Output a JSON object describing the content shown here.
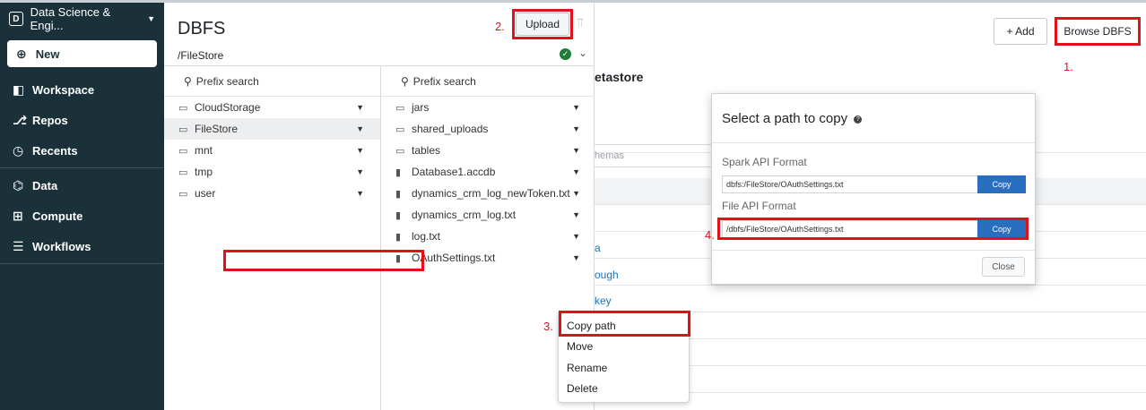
{
  "sidebar": {
    "workspace_badge": "D",
    "workspace_name": "Data Science & Engi...",
    "workspace_caret": "▼",
    "new_label": "New",
    "items": [
      {
        "label": "Workspace",
        "icon": "workspace-icon",
        "glyph": "◧"
      },
      {
        "label": "Repos",
        "icon": "repos-icon",
        "glyph": "⎇"
      },
      {
        "label": "Recents",
        "icon": "clock-icon",
        "glyph": "◷"
      },
      {
        "label": "Data",
        "icon": "data-icon",
        "glyph": "⌬"
      },
      {
        "label": "Compute",
        "icon": "compute-icon",
        "glyph": "⊞"
      },
      {
        "label": "Workflows",
        "icon": "workflows-icon",
        "glyph": "☰"
      }
    ]
  },
  "dbfs": {
    "title": "DBFS",
    "upload_label": "Upload",
    "path": "/FileStore",
    "search_placeholder": "Prefix search",
    "left_folders": [
      "CloudStorage",
      "FileStore",
      "mnt",
      "tmp",
      "user"
    ],
    "selected_folder": "FileStore",
    "right_items": [
      {
        "name": "jars",
        "type": "folder"
      },
      {
        "name": "shared_uploads",
        "type": "folder"
      },
      {
        "name": "tables",
        "type": "folder"
      },
      {
        "name": "Database1.accdb",
        "type": "file"
      },
      {
        "name": "dynamics_crm_log_newToken.txt",
        "type": "file"
      },
      {
        "name": "dynamics_crm_log.txt",
        "type": "file"
      },
      {
        "name": "log.txt",
        "type": "file"
      },
      {
        "name": "OAuthSettings.txt",
        "type": "file"
      }
    ]
  },
  "context_menu": {
    "items": [
      "Copy path",
      "Move",
      "Rename",
      "Delete"
    ]
  },
  "step_numbers": {
    "one": "1.",
    "two": "2.",
    "three": "3.",
    "four": "4."
  },
  "background": {
    "add_label": "+ Add",
    "browse_label": "Browse DBFS",
    "heading_fragment": "etastore",
    "search_fragment": "hemas",
    "link_a": "a",
    "link_ough": "ough",
    "link_key": "key"
  },
  "modal": {
    "title": "Select a path to copy",
    "spark_label": "Spark API Format",
    "spark_value": "dbfs:/FileStore/OAuthSettings.txt",
    "file_label": "File API Format",
    "file_value": "/dbfs/FileStore/OAuthSettings.txt",
    "copy_label": "Copy",
    "close_label": "Close"
  },
  "colors": {
    "sidebar_bg": "#1b3139",
    "annotation_red": "#e0111b",
    "copy_blue": "#2a6fbf"
  }
}
